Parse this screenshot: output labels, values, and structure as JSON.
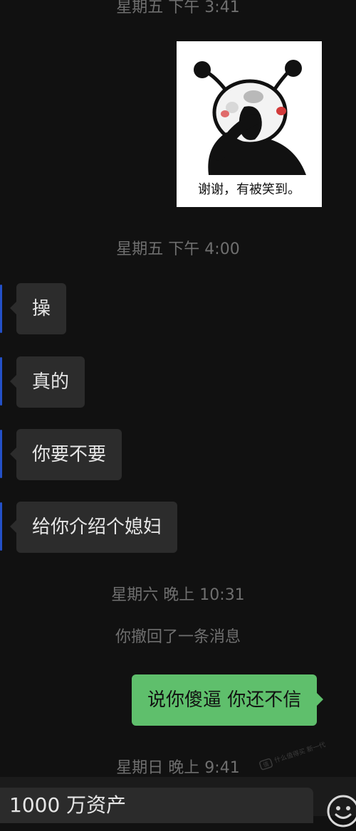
{
  "conversation": {
    "timestamps": [
      "星期五 下午 3:41",
      "星期五 下午 4:00",
      "星期六 晚上 10:31",
      "星期日 晚上 9:41"
    ],
    "sticker": {
      "caption": "谢谢，有被笑到。"
    },
    "received_messages": [
      "操",
      "真的",
      "你要不要",
      "给你介绍个媳妇"
    ],
    "recall_notice": "你撤回了一条消息",
    "sent_messages": [
      "说你傻逼  你还不信"
    ]
  },
  "input": {
    "value": "1000 万资产"
  },
  "watermark": {
    "text": "什么值得买 新一代"
  },
  "colors": {
    "background": "#111111",
    "received_bubble": "#2c2c2c",
    "sent_bubble": "#5fbf6c",
    "timestamp": "#6f6f6f"
  },
  "icons": {
    "emoji_button": "smiley-face-icon"
  }
}
